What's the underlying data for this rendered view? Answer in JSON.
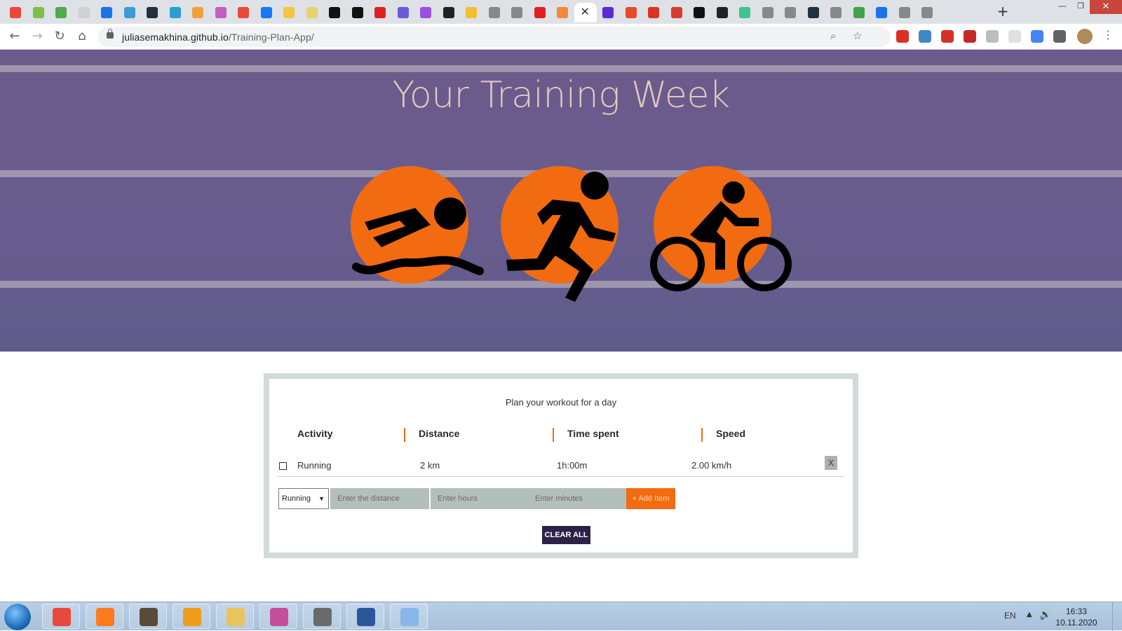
{
  "browser": {
    "url_host": "juliasemakhina.github.io",
    "url_path": "/Training-Plan-App/",
    "tab_favicon_colors": [
      "#e8493c",
      "#7cc04a",
      "#53a84a",
      "#d0d0d0",
      "#1a73e8",
      "#3f9ad8",
      "#222f3e",
      "#2a9ed8",
      "#f1a13a",
      "#c25ec2",
      "#e8493c",
      "#1877f2",
      "#f4c542",
      "#e5d46c",
      "#111111",
      "#111111",
      "#e02020",
      "#6a5bd8",
      "#9a4fe0",
      "#222222",
      "#f0c02f",
      "#888888",
      "#888888",
      "#e02020",
      "#f08a3a",
      "#ffffff",
      "#5b2ad1",
      "#e54a2a",
      "#d9341f",
      "#d43b2f",
      "#111111",
      "#222222",
      "#3ec48f",
      "#888888",
      "#888888",
      "#222f3e",
      "#888888",
      "#3fa44a",
      "#1a73e8",
      "#888888",
      "#888888"
    ],
    "active_tab_close": "✕",
    "new_tab": "+",
    "nav_back": "←",
    "nav_forward": "→",
    "nav_reload": "↻",
    "nav_home": "⌂",
    "zoom_icon": "⌕",
    "star_icon": "☆",
    "extension_colors": [
      "#d93025",
      "#3f88c5",
      "#d93025",
      "#c62828",
      "#bdbdbd",
      "#e0e0e0",
      "#4285f4",
      "#5f6368"
    ],
    "menu": "⋮",
    "window_controls": [
      "—",
      "❐",
      "✕"
    ]
  },
  "hero": {
    "title": "Your Training Week",
    "accent_color": "#f26b10",
    "icons": [
      "swimming-icon",
      "running-icon",
      "cycling-icon"
    ]
  },
  "planner": {
    "subtitle": "Plan your workout for a day",
    "columns": [
      "Activity",
      "Distance",
      "Time spent",
      "Speed"
    ],
    "rows": [
      {
        "activity": "Running",
        "distance": "2 km",
        "time": "1h:00m",
        "speed": "2.00 km/h",
        "delete_label": "X"
      }
    ],
    "form": {
      "activity_value": "Running",
      "select_arrow": "▼",
      "distance_placeholder": "Enter the distance",
      "hours_placeholder": "Enter hours",
      "minutes_placeholder": "Enter minutes",
      "add_label": "+ Add Item"
    },
    "clear_label": "CLEAR ALL"
  },
  "taskbar": {
    "apps": [
      "chrome",
      "firefox",
      "photo-viewer",
      "sublime-text",
      "file-explorer",
      "gitkraken",
      "misc-app",
      "word",
      "paint"
    ],
    "app_colors": [
      "#e8493c",
      "#ff7a1a",
      "#5a4a3a",
      "#f09b1a",
      "#e8c45a",
      "#c54f9b",
      "#6a6a6a",
      "#2b579a",
      "#86b7e8"
    ],
    "lang": "EN",
    "tray_arrow": "▲",
    "volume": "🔊",
    "time": "16:33",
    "date": "10.11.2020"
  }
}
